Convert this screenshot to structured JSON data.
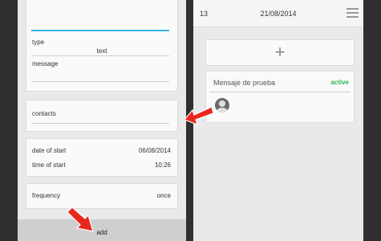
{
  "form": {
    "type_label": "type",
    "type_value": "text",
    "message_label": "message",
    "contacts_label": "contacts",
    "date_label": "date of start",
    "date_value": "06/08/2014",
    "time_label": "time of start",
    "time_value": "10:26",
    "frequency_label": "frequency",
    "frequency_value": "once",
    "add_label": "add"
  },
  "list": {
    "count": "13",
    "date": "21/08/2014",
    "add_glyph": "+",
    "item_title": "Mensaje de prueba",
    "item_status": "active"
  },
  "colors": {
    "active": "#2db84d",
    "accent": "#33b5e5",
    "arrow": "#e8281e"
  }
}
